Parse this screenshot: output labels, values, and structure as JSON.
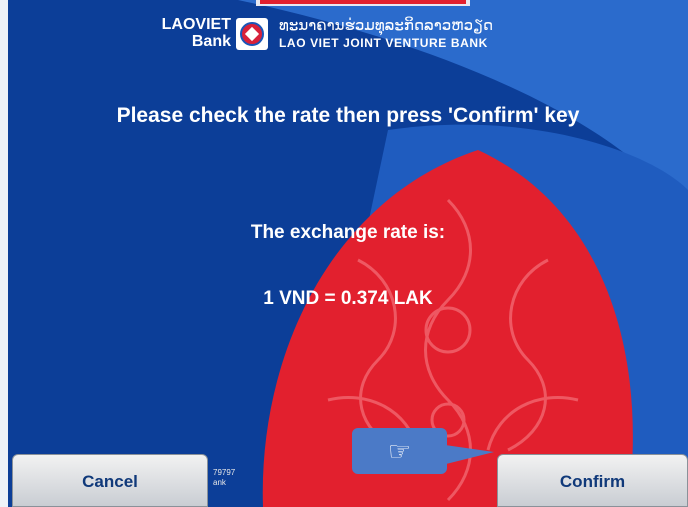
{
  "brand": {
    "name_line1": "LAOVIET",
    "name_line2": "Bank",
    "name_lao": "ທະນາຄານຮ່ວມທຸລະກິດລາວຫວຽດ",
    "name_english": "LAO VIET JOINT VENTURE BANK"
  },
  "screen": {
    "instruction": "Please check the rate then press 'Confirm' key",
    "rate_label": "The exchange rate is:",
    "rate_value": "1 VND = 0.374 LAK"
  },
  "buttons": {
    "cancel": "Cancel",
    "confirm": "Confirm"
  },
  "footer": {
    "line1": "79797",
    "line2": "ank"
  },
  "pointer": {
    "icon": "hand-pointing-right-icon",
    "glyph": "☞"
  },
  "colors": {
    "background_blue": "#0c3e98",
    "accent_red": "#e2202e",
    "light_blue": "#2d6fd1",
    "button_text": "#10397a"
  }
}
